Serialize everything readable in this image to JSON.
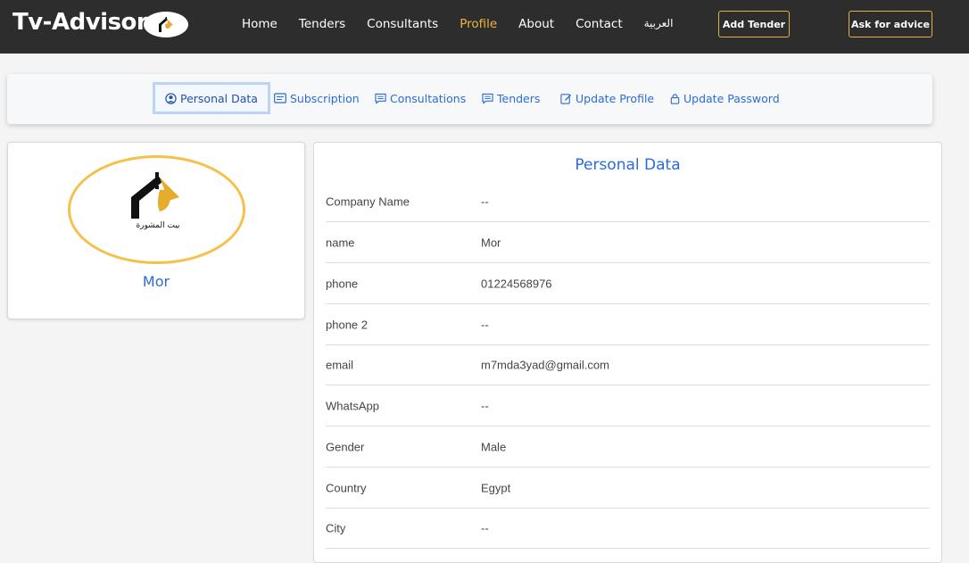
{
  "header": {
    "brand": "Tv-Advisor",
    "nav": [
      "Home",
      "Tenders",
      "Consultants",
      "Profile",
      "About",
      "Contact",
      "العربية"
    ],
    "active_nav": "Profile",
    "add_tender": "Add Tender",
    "ask_advice": "Ask for advice"
  },
  "tabs": [
    {
      "label": "Personal Data",
      "icon": "user-circle-icon"
    },
    {
      "label": "Subscription",
      "icon": "card-icon"
    },
    {
      "label": "Consultations",
      "icon": "message-icon"
    },
    {
      "label": "Tenders",
      "icon": "message-icon"
    },
    {
      "label": "Update Profile",
      "icon": "edit-icon"
    },
    {
      "label": "Update Password",
      "icon": "lock-icon"
    }
  ],
  "active_tab": "Personal Data",
  "profile": {
    "name": "Mor",
    "logo_text": "بيت المشورة"
  },
  "personal_data": {
    "title": "Personal Data",
    "rows": [
      {
        "label": "Company Name",
        "value": "--"
      },
      {
        "label": "name",
        "value": "Mor"
      },
      {
        "label": "phone",
        "value": "01224568976"
      },
      {
        "label": "phone 2",
        "value": "--"
      },
      {
        "label": "email",
        "value": "m7mda3yad@gmail.com"
      },
      {
        "label": "WhatsApp",
        "value": "--"
      },
      {
        "label": "Gender",
        "value": "Male"
      },
      {
        "label": "Country",
        "value": "Egypt"
      },
      {
        "label": "City",
        "value": "--"
      }
    ]
  },
  "colors": {
    "nav_bg": "#2d2d2d",
    "accent": "#f2b53a",
    "link": "#2a6bd6"
  }
}
